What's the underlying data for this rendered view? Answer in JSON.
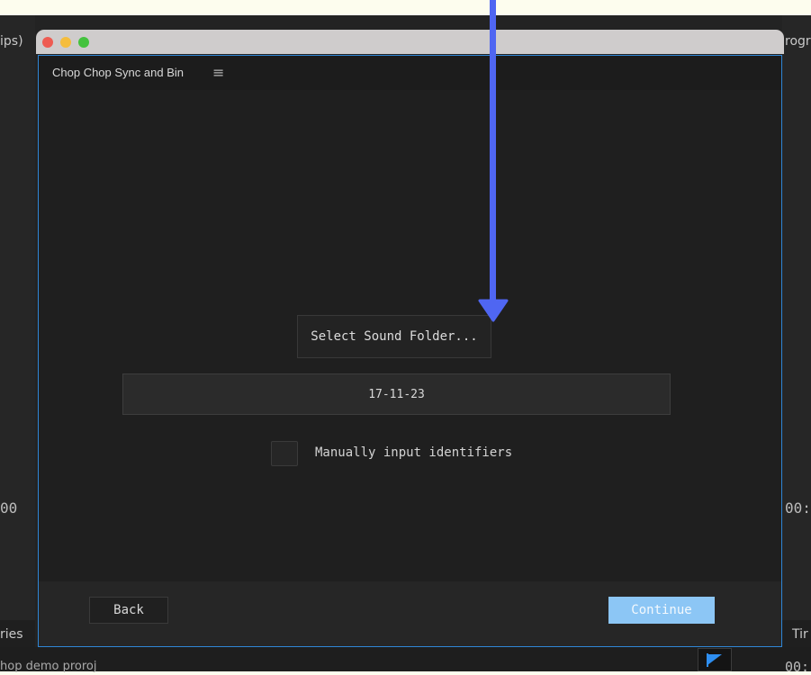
{
  "background": {
    "left_top_label": "ips)",
    "right_top_label": "rogra",
    "left_timecode": "00",
    "right_timecode": "00:",
    "left_bottom_label": "ries",
    "right_bottom_label": "Tir",
    "bottom_project_label": "hop demo proroj",
    "right_bottom_timecode": "00:"
  },
  "window": {
    "traffic_lights": [
      "close",
      "minimize",
      "maximize"
    ]
  },
  "panel": {
    "title": "Chop Chop Sync and Bin",
    "menu_icon": "≡",
    "select_folder_label": "Select Sound Folder...",
    "folder_value": "17-11-23",
    "manual_checkbox_label": "Manually input identifiers",
    "manual_checkbox_checked": false,
    "back_label": "Back",
    "continue_label": "Continue"
  },
  "colors": {
    "accent": "#8cc6f5",
    "panel_border": "#2f86d6",
    "annotation_arrow": "#4f66f2"
  },
  "annotation": {
    "icon": "down-arrow-icon"
  }
}
